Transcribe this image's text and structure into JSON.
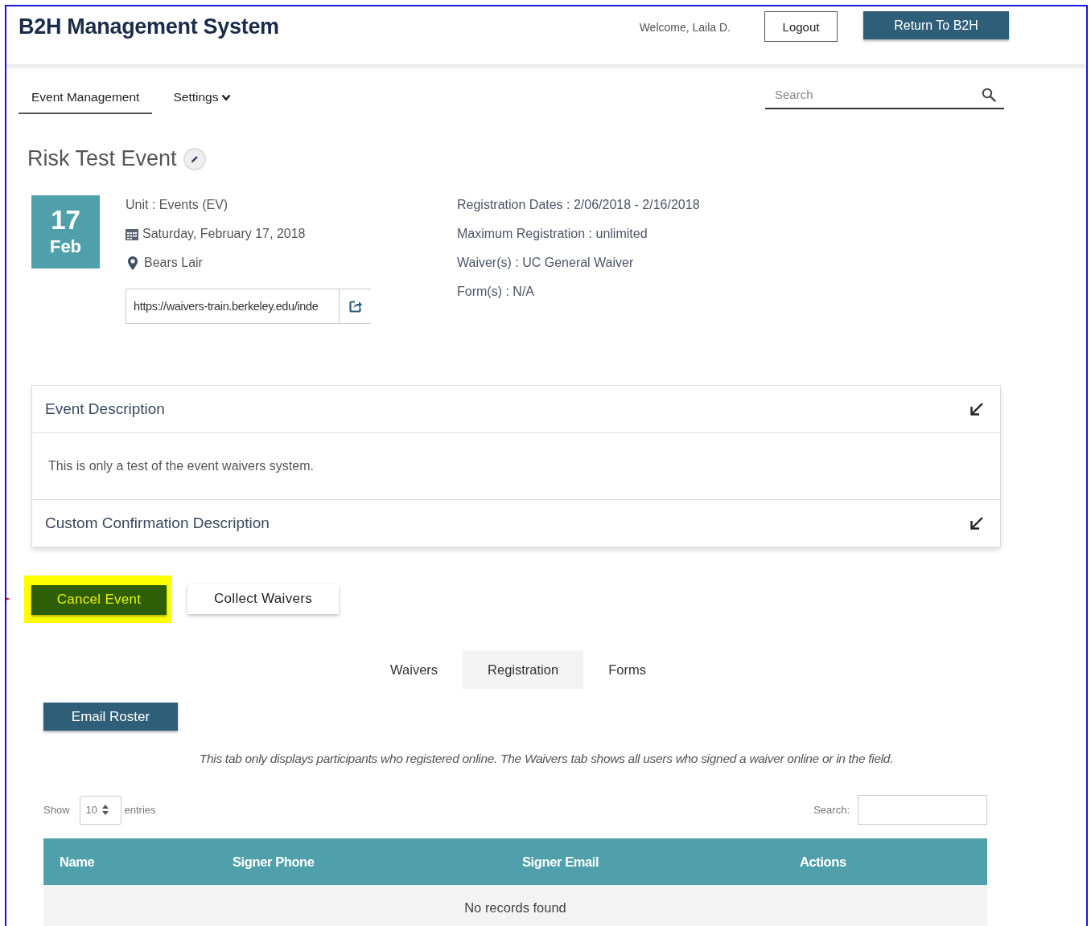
{
  "app": {
    "title": "B2H Management System",
    "welcome": "Welcome, Laila D.",
    "logout": "Logout",
    "return_button": "Return To B2H"
  },
  "nav": {
    "items": [
      {
        "label": "Event Management",
        "kind": "link",
        "selected": true
      },
      {
        "label": "Settings",
        "kind": "dropdown",
        "selected": false
      }
    ],
    "search": {
      "placeholder": "Search"
    }
  },
  "event": {
    "title": "Risk Test Event",
    "day": "17",
    "month": "Feb",
    "unit": "Unit : Events (EV)",
    "date": "Saturday, February 17, 2018",
    "location": "Bears Lair",
    "url": "https://waivers-train.berkeley.edu/inde",
    "details": [
      "Registration Dates : 2/06/2018 - 2/16/2018",
      "Maximum Registration : unlimited",
      "Waiver(s) : UC General Waiver",
      "Form(s) : N/A"
    ]
  },
  "panels": [
    {
      "title": "Event Description",
      "expanded": true,
      "body": "This is only a test of the event waivers system."
    },
    {
      "title": "Custom Confirmation Description",
      "expanded": false
    }
  ],
  "actions": [
    {
      "label": "Cancel Event",
      "kind": "danger",
      "highlighted": true
    },
    {
      "label": "Collect Waivers",
      "kind": "default",
      "highlighted": false
    }
  ],
  "tabs": [
    {
      "label": "Waivers",
      "selected": false
    },
    {
      "label": "Registration",
      "selected": true
    },
    {
      "label": "Forms",
      "selected": false
    }
  ],
  "email_roster": "Email Roster",
  "note": "This tab only displays participants who registered online. The Waivers tab shows all users who signed a waiver online or in the field.",
  "table": {
    "show": "Show",
    "length": "10",
    "entries": "entries",
    "search_label": "Search:",
    "columns": [
      "Name",
      "Signer Phone",
      "Signer Email",
      "Actions"
    ],
    "empty": "No records found"
  }
}
